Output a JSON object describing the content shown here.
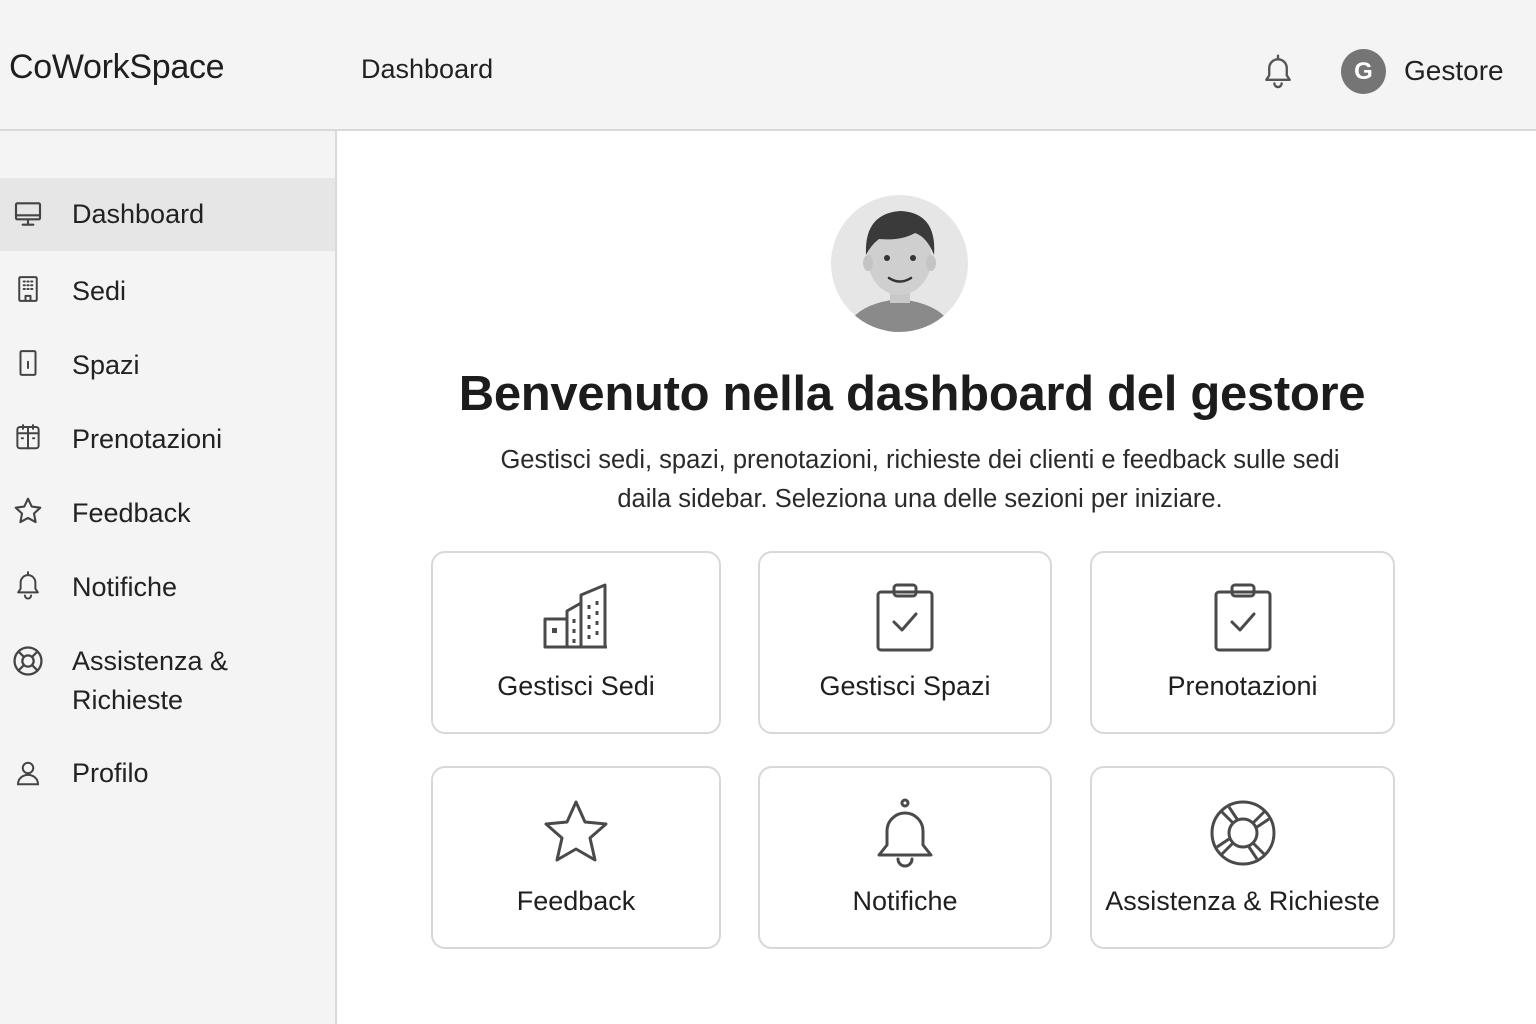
{
  "header": {
    "brand": "CoWorkSpace",
    "page_title": "Dashboard",
    "notification_icon": "bell-icon",
    "user_initial": "G",
    "user_name": "Gestore"
  },
  "sidebar": {
    "items": [
      {
        "label": "Dashboard",
        "icon": "monitor-icon",
        "active": true
      },
      {
        "label": "Sedi",
        "icon": "building-icon"
      },
      {
        "label": "Spazi",
        "icon": "door-icon"
      },
      {
        "label": "Prenotazioni",
        "icon": "calendar-icon"
      },
      {
        "label": "Feedback",
        "icon": "star-icon"
      },
      {
        "label": "Notifiche",
        "icon": "bell-icon"
      },
      {
        "label": "Assistenza &",
        "label_line2": "Richieste",
        "icon": "lifebuoy-icon"
      },
      {
        "label": "Profilo",
        "icon": "user-icon"
      }
    ]
  },
  "main": {
    "avatar_icon": "user-avatar",
    "welcome_title": "Benvenuto nella dashboard del gestore",
    "subtitle_line1": "Gestisci sedi, spazi, prenotazioni, richieste dei clienti e feedback sulle sedi",
    "subtitle_line2": "daila sidebar. Seleziona una delle sezioni per iniziare.",
    "cards": [
      {
        "label": "Gestisci Sedi",
        "icon": "building-icon"
      },
      {
        "label": "Gestisci Spazi",
        "icon": "clipboard-check-icon"
      },
      {
        "label": "Prenotazioni",
        "icon": "clipboard-check-icon"
      },
      {
        "label": "Feedback",
        "icon": "star-icon"
      },
      {
        "label": "Notifiche",
        "icon": "bell-icon"
      },
      {
        "label": "Assistenza & Richieste",
        "icon": "lifebuoy-icon"
      }
    ]
  }
}
